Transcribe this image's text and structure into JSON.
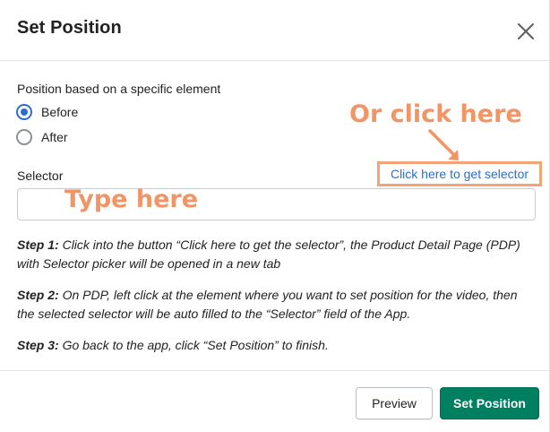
{
  "modal": {
    "title": "Set Position",
    "close_icon": "close-icon"
  },
  "position": {
    "label": "Position based on a specific element",
    "options": [
      {
        "label": "Before",
        "checked": true
      },
      {
        "label": "After",
        "checked": false
      }
    ]
  },
  "selector": {
    "label": "Selector",
    "link_text": "Click here to get selector",
    "value": "",
    "placeholder": ""
  },
  "annotations": {
    "click_hint": "Or click here",
    "type_hint": "Type here",
    "color": "#ef9566"
  },
  "steps": [
    {
      "prefix": "Step 1:",
      "text": " Click into the button “Click here to get the selector”, the Product Detail Page (PDP) with Selector picker will be opened in a new tab"
    },
    {
      "prefix": "Step 2:",
      "text": " On PDP, left click at the element where you want to set position for the video, then the selected selector will be auto filled to the “Selector” field of the App."
    },
    {
      "prefix": "Step 3:",
      "text": " Go back to the app, click “Set Position” to finish."
    }
  ],
  "footer": {
    "preview_label": "Preview",
    "primary_label": "Set Position"
  },
  "colors": {
    "primary": "#008060",
    "link": "#2c6ecb",
    "radio_checked": "#2c6ecb",
    "highlight_box": "#f2a377"
  }
}
